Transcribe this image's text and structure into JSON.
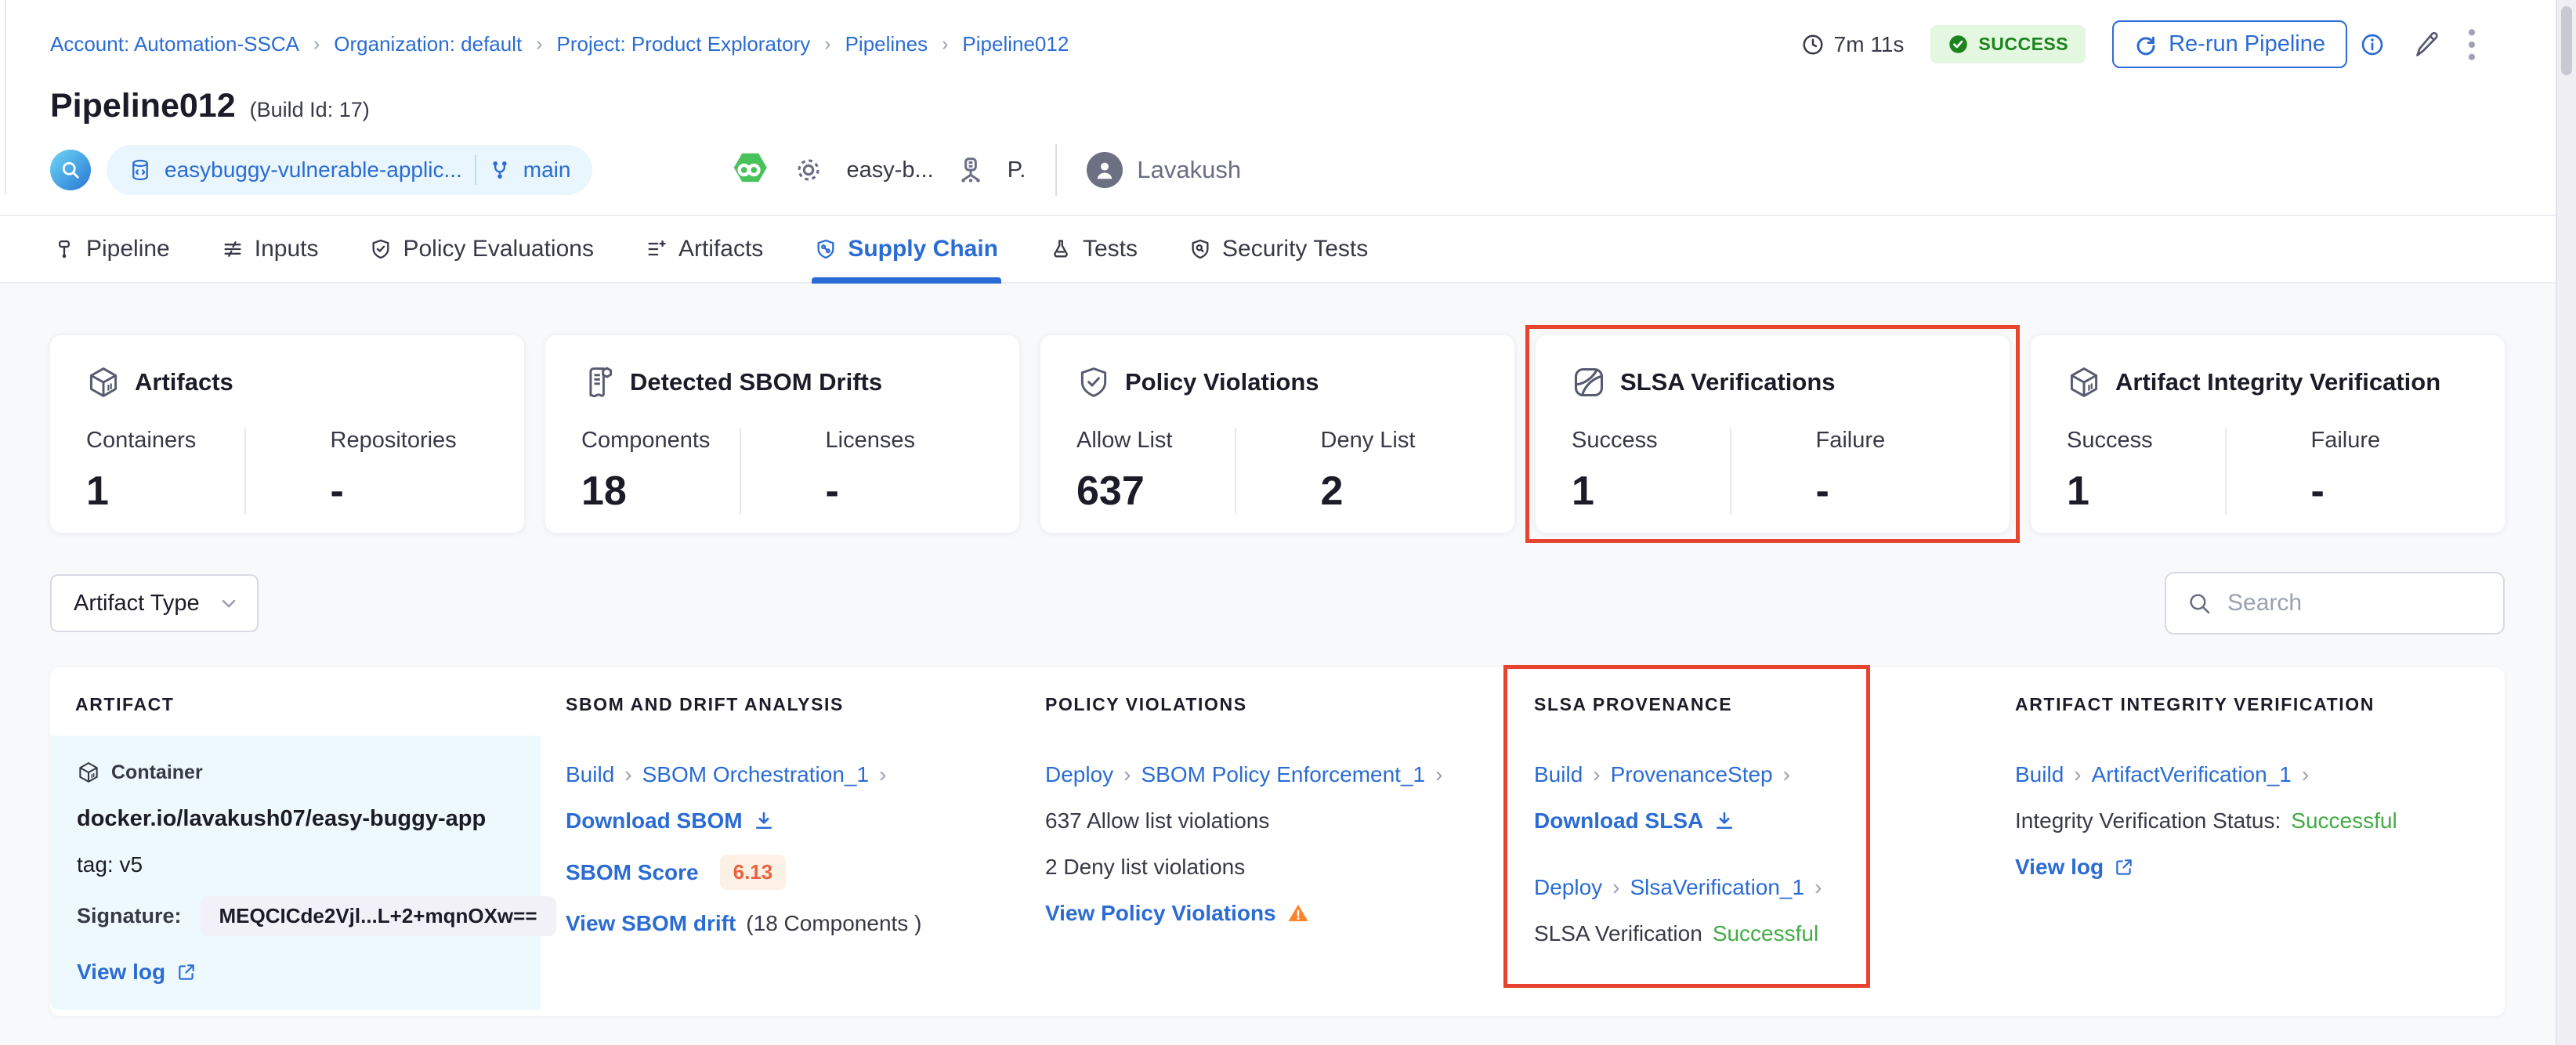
{
  "ui": {
    "chevron": "›"
  },
  "breadcrumb": {
    "items": [
      {
        "label": "Account: Automation-SSCA"
      },
      {
        "label": "Organization: default"
      },
      {
        "label": "Project: Product Exploratory"
      },
      {
        "label": "Pipelines"
      },
      {
        "label": "Pipeline012"
      }
    ]
  },
  "header": {
    "title": "Pipeline012",
    "build_id": "(Build Id: 17)",
    "duration": "7m 11s",
    "status_badge": "SUCCESS",
    "rerun_button": "Re-run Pipeline",
    "repo_name": "easybuggy-vulnerable-applic...",
    "branch_name": "main",
    "trigger_name": "easy-b...",
    "trigger_short": "P.",
    "user_name": "Lavakush"
  },
  "tabs": [
    {
      "label": "Pipeline",
      "active": false
    },
    {
      "label": "Inputs",
      "active": false
    },
    {
      "label": "Policy Evaluations",
      "active": false
    },
    {
      "label": "Artifacts",
      "active": false
    },
    {
      "label": "Supply Chain",
      "active": true
    },
    {
      "label": "Tests",
      "active": false
    },
    {
      "label": "Security Tests",
      "active": false
    }
  ],
  "summary_cards": [
    {
      "title": "Artifacts",
      "icon": "cube-icon",
      "highlighted": false,
      "metric1": {
        "label": "Containers",
        "value": "1"
      },
      "metric2": {
        "label": "Repositories",
        "value": "-"
      }
    },
    {
      "title": "Detected SBOM Drifts",
      "icon": "sbom-document-icon",
      "highlighted": false,
      "metric1": {
        "label": "Components",
        "value": "18"
      },
      "metric2": {
        "label": "Licenses",
        "value": "-"
      }
    },
    {
      "title": "Policy Violations",
      "icon": "shield-check-icon",
      "highlighted": false,
      "metric1": {
        "label": "Allow List",
        "value": "637"
      },
      "metric2": {
        "label": "Deny List",
        "value": "2"
      }
    },
    {
      "title": "SLSA Verifications",
      "icon": "slsa-icon",
      "highlighted": true,
      "metric1": {
        "label": "Success",
        "value": "1"
      },
      "metric2": {
        "label": "Failure",
        "value": "-"
      }
    },
    {
      "title": "Artifact Integrity Verification",
      "icon": "cube-icon",
      "highlighted": false,
      "metric1": {
        "label": "Success",
        "value": "1"
      },
      "metric2": {
        "label": "Failure",
        "value": "-"
      }
    }
  ],
  "filters": {
    "artifact_type_label": "Artifact Type",
    "search_placeholder": "Search"
  },
  "table": {
    "headers": [
      "ARTIFACT",
      "SBOM AND DRIFT ANALYSIS",
      "POLICY VIOLATIONS",
      "SLSA PROVENANCE",
      "ARTIFACT INTEGRITY VERIFICATION"
    ],
    "row": {
      "artifact": {
        "type": "Container",
        "image": "docker.io/lavakush07/easy-buggy-app",
        "tag": "tag: v5",
        "signature_label": "Signature:",
        "signature_value": "MEQCICde2Vjl...L+2+mqnOXw==",
        "view_log": "View log"
      },
      "sbom": {
        "stage": "Build",
        "step": "SBOM Orchestration_1",
        "download": "Download SBOM",
        "score_label": "SBOM Score",
        "score_value": "6.13",
        "drift_link": "View SBOM drift",
        "drift_note": "(18 Components )"
      },
      "policy": {
        "stage": "Deploy",
        "step": "SBOM Policy Enforcement_1",
        "allow_text": "637 Allow list violations",
        "deny_text": "2 Deny list violations",
        "view_link": "View Policy Violations"
      },
      "slsa": {
        "stage1": "Build",
        "step1": "ProvenanceStep",
        "download": "Download SLSA",
        "stage2": "Deploy",
        "step2": "SlsaVerification_1",
        "status_label": "SLSA Verification",
        "status_value": "Successful"
      },
      "integrity": {
        "stage": "Build",
        "step": "ArtifactVerification_1",
        "status_label": "Integrity Verification Status:",
        "status_value": "Successful",
        "view_log": "View log"
      }
    }
  },
  "colors": {
    "primary_blue": "#2b6cd4",
    "success_green": "#42ab45",
    "badge_green_bg": "#e4f7e1",
    "badge_green_text": "#1b841d",
    "warning_orange": "#ff832b",
    "score_orange": "#e8643c",
    "score_bg": "#fdf0e6",
    "highlight_red": "#e8432e",
    "artifact_cell_bg": "#eef9fd"
  }
}
